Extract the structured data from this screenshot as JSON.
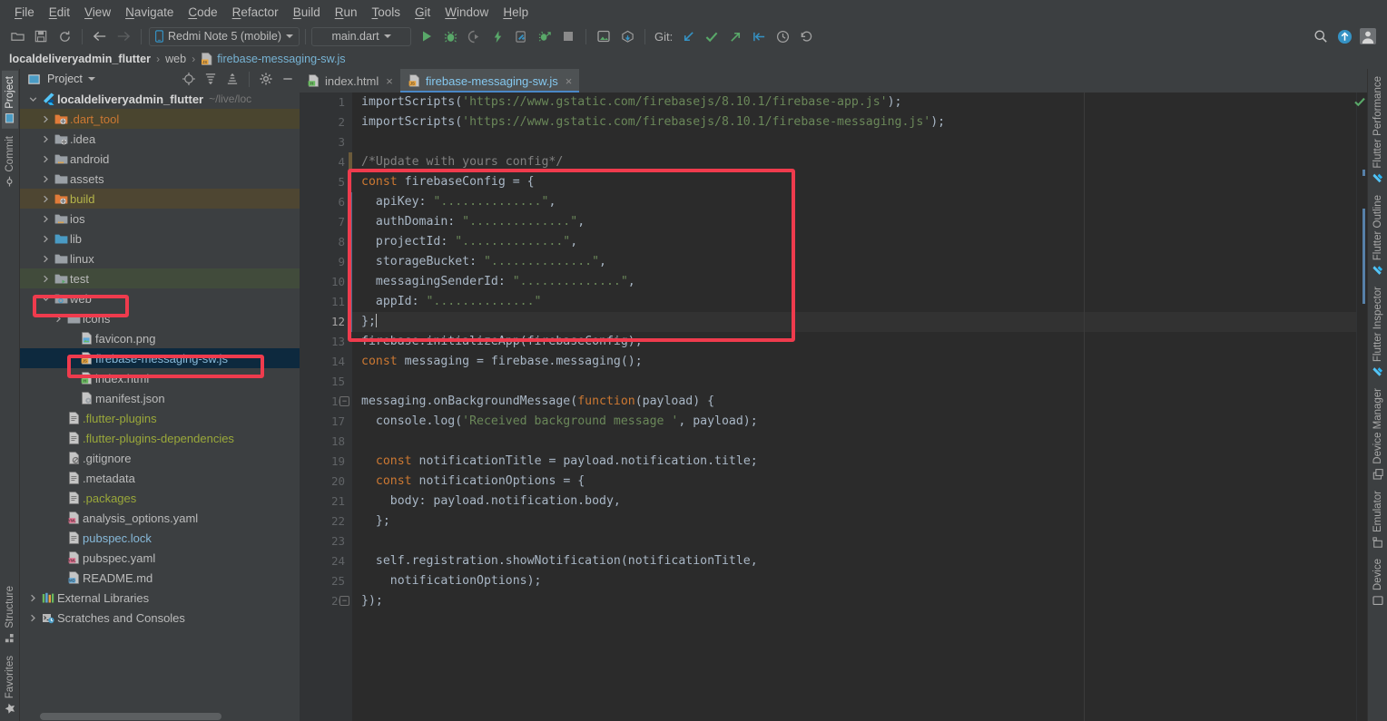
{
  "menubar": {
    "items": [
      "File",
      "Edit",
      "View",
      "Navigate",
      "Code",
      "Refactor",
      "Build",
      "Run",
      "Tools",
      "Git",
      "Window",
      "Help"
    ]
  },
  "toolbar": {
    "icons": [
      "open-folder-icon",
      "save-icon",
      "sync-icon"
    ],
    "nav_back": "back-arrow-icon",
    "nav_forward": "forward-arrow-icon",
    "device_selector": "Redmi Note 5 (mobile)",
    "run_config": "main.dart",
    "run_icons": [
      "run-icon",
      "debug-icon",
      "run-coverage-icon",
      "hot-reload-icon",
      "hot-restart-icon",
      "profile-icon",
      "stop-icon"
    ],
    "device_icons": [
      "open-android-emulator-icon",
      "device-file-explorer-icon"
    ],
    "git_label": "Git:",
    "git_icons": [
      "git-pull-icon",
      "git-commit-icon",
      "git-push-icon",
      "git-update-project-icon",
      "git-history-icon",
      "git-rollback-icon"
    ],
    "right_icons": [
      "search-icon",
      "update-available-icon",
      "avatar-icon"
    ]
  },
  "breadcrumb": {
    "project": "localdeliveryadmin_flutter",
    "folder": "web",
    "file": "firebase-messaging-sw.js",
    "separator": "›"
  },
  "left_rail": {
    "top": [
      {
        "label": "Project",
        "icon": "project-icon",
        "active": true
      },
      {
        "label": "Commit",
        "icon": "commit-icon",
        "active": false
      }
    ],
    "bottom": [
      {
        "label": "Structure",
        "icon": "structure-icon"
      },
      {
        "label": "Favorites",
        "icon": "star-icon"
      }
    ]
  },
  "right_rail": {
    "items": [
      {
        "label": "Flutter Performance",
        "icon": "flutter-icon"
      },
      {
        "label": "Flutter Outline",
        "icon": "flutter-icon"
      },
      {
        "label": "Flutter Inspector",
        "icon": "flutter-icon"
      },
      {
        "label": "Device Manager",
        "icon": "device-manager-icon"
      },
      {
        "label": "Emulator",
        "icon": "emulator-icon"
      },
      {
        "label": "Device",
        "icon": "device-icon"
      }
    ]
  },
  "project_panel": {
    "title": "Project",
    "title_caret": "chevron-down-icon",
    "toolbar_icons": [
      "select-opened-file-icon",
      "expand-all-icon",
      "collapse-all-icon",
      "settings-gear-icon",
      "hide-panel-icon"
    ],
    "tree": [
      {
        "label": "localdeliveryadmin_flutter",
        "path": "~/live/loc",
        "icon": "flutter-project-icon",
        "indent": 0,
        "arrow": "expanded",
        "bold": true,
        "highlight": "none"
      },
      {
        "label": ".dart_tool",
        "icon": "folder-excluded-icon",
        "indent": 1,
        "arrow": "collapsed",
        "color": "#cc7832",
        "highlight": "dart"
      },
      {
        "label": ".idea",
        "icon": "folder-module-icon",
        "indent": 1,
        "arrow": "collapsed",
        "color": "#bbbbbb",
        "highlight": "none"
      },
      {
        "label": "android",
        "icon": "folder-source-icon",
        "indent": 1,
        "arrow": "collapsed",
        "color": "#bbbbbb",
        "highlight": "none"
      },
      {
        "label": "assets",
        "icon": "folder-icon",
        "indent": 1,
        "arrow": "collapsed",
        "color": "#bbbbbb",
        "highlight": "none"
      },
      {
        "label": "build",
        "icon": "folder-excluded-icon",
        "indent": 1,
        "arrow": "collapsed",
        "color": "#b5b54a",
        "highlight": "build"
      },
      {
        "label": "ios",
        "icon": "folder-source-icon",
        "indent": 1,
        "arrow": "collapsed",
        "color": "#bbbbbb",
        "highlight": "none"
      },
      {
        "label": "lib",
        "icon": "folder-blue-icon",
        "indent": 1,
        "arrow": "collapsed",
        "color": "#bbbbbb",
        "highlight": "none"
      },
      {
        "label": "linux",
        "icon": "folder-icon",
        "indent": 1,
        "arrow": "collapsed",
        "color": "#bbbbbb",
        "highlight": "none"
      },
      {
        "label": "test",
        "icon": "folder-test-icon",
        "indent": 1,
        "arrow": "collapsed",
        "color": "#bbbbbb",
        "highlight": "test"
      },
      {
        "label": "web",
        "icon": "folder-web-icon",
        "indent": 1,
        "arrow": "expanded",
        "color": "#bbbbbb",
        "highlight": "none",
        "redbox": true
      },
      {
        "label": "icons",
        "icon": "folder-icon",
        "indent": 2,
        "arrow": "collapsed",
        "color": "#bbbbbb",
        "highlight": "none"
      },
      {
        "label": "favicon.png",
        "icon": "image-file-icon",
        "indent": 3,
        "arrow": "none",
        "color": "#bbbbbb",
        "highlight": "none"
      },
      {
        "label": "firebase-messaging-sw.js",
        "icon": "js-file-icon",
        "indent": 3,
        "arrow": "none",
        "color": "#87b9d9",
        "highlight": "selected",
        "redbox": true
      },
      {
        "label": "index.html",
        "icon": "html-file-icon",
        "indent": 3,
        "arrow": "none",
        "color": "#bbbbbb",
        "highlight": "none"
      },
      {
        "label": "manifest.json",
        "icon": "json-file-icon",
        "indent": 3,
        "arrow": "none",
        "color": "#bbbbbb",
        "highlight": "none"
      },
      {
        "label": ".flutter-plugins",
        "icon": "text-file-icon",
        "indent": 2,
        "arrow": "none",
        "color": "#9aa83a",
        "highlight": "none"
      },
      {
        "label": ".flutter-plugins-dependencies",
        "icon": "text-file-icon",
        "indent": 2,
        "arrow": "none",
        "color": "#9aa83a",
        "highlight": "none"
      },
      {
        "label": ".gitignore",
        "icon": "gitignore-file-icon",
        "indent": 2,
        "arrow": "none",
        "color": "#bbbbbb",
        "highlight": "none"
      },
      {
        "label": ".metadata",
        "icon": "text-file-icon",
        "indent": 2,
        "arrow": "none",
        "color": "#bbbbbb",
        "highlight": "none"
      },
      {
        "label": ".packages",
        "icon": "text-file-icon",
        "indent": 2,
        "arrow": "none",
        "color": "#9aa83a",
        "highlight": "none"
      },
      {
        "label": "analysis_options.yaml",
        "icon": "yaml-file-icon",
        "indent": 2,
        "arrow": "none",
        "color": "#bbbbbb",
        "highlight": "none"
      },
      {
        "label": "pubspec.lock",
        "icon": "text-file-icon",
        "indent": 2,
        "arrow": "none",
        "color": "#87b9d9",
        "highlight": "none"
      },
      {
        "label": "pubspec.yaml",
        "icon": "yaml-file-icon",
        "indent": 2,
        "arrow": "none",
        "color": "#bbbbbb",
        "highlight": "none"
      },
      {
        "label": "README.md",
        "icon": "markdown-file-icon",
        "indent": 2,
        "arrow": "none",
        "color": "#bbbbbb",
        "highlight": "none"
      },
      {
        "label": "External Libraries",
        "icon": "libraries-icon",
        "indent": 0,
        "arrow": "collapsed",
        "color": "#bbbbbb",
        "highlight": "none"
      },
      {
        "label": "Scratches and Consoles",
        "icon": "scratches-icon",
        "indent": 0,
        "arrow": "collapsed",
        "color": "#bbbbbb",
        "highlight": "none"
      }
    ]
  },
  "editor": {
    "tabs": [
      {
        "label": "index.html",
        "icon": "html-file-icon",
        "active": false,
        "close": "×"
      },
      {
        "label": "firebase-messaging-sw.js",
        "icon": "js-file-icon",
        "active": true,
        "close": "×"
      }
    ],
    "current_line": 12,
    "inspection_status": "ok-check-icon",
    "lines": [
      {
        "n": 1,
        "tokens": [
          {
            "t": "importScripts(",
            "c": "txt"
          },
          {
            "t": "'https://www.gstatic.com/firebasejs/8.10.1/firebase-app.js'",
            "c": "str"
          },
          {
            "t": ");",
            "c": "txt"
          }
        ]
      },
      {
        "n": 2,
        "tokens": [
          {
            "t": "importScripts(",
            "c": "txt"
          },
          {
            "t": "'https://www.gstatic.com/firebasejs/8.10.1/firebase-messaging.js'",
            "c": "str"
          },
          {
            "t": ");",
            "c": "txt"
          }
        ]
      },
      {
        "n": 3,
        "tokens": []
      },
      {
        "n": 4,
        "tokens": [
          {
            "t": "/*Update with yours config*/",
            "c": "cmt"
          }
        ]
      },
      {
        "n": 5,
        "tokens": [
          {
            "t": "const",
            "c": "kw"
          },
          {
            "t": " firebaseConfig = {",
            "c": "txt"
          }
        ]
      },
      {
        "n": 6,
        "tokens": [
          {
            "t": "  apiKey: ",
            "c": "txt"
          },
          {
            "t": "\"..............\"",
            "c": "str"
          },
          {
            "t": ",",
            "c": "txt"
          }
        ]
      },
      {
        "n": 7,
        "tokens": [
          {
            "t": "  authDomain: ",
            "c": "txt"
          },
          {
            "t": "\"..............\"",
            "c": "str"
          },
          {
            "t": ",",
            "c": "txt"
          }
        ]
      },
      {
        "n": 8,
        "tokens": [
          {
            "t": "  projectId: ",
            "c": "txt"
          },
          {
            "t": "\"..............\"",
            "c": "str"
          },
          {
            "t": ",",
            "c": "txt"
          }
        ]
      },
      {
        "n": 9,
        "tokens": [
          {
            "t": "  storageBucket: ",
            "c": "txt"
          },
          {
            "t": "\"..............\"",
            "c": "str"
          },
          {
            "t": ",",
            "c": "txt"
          }
        ]
      },
      {
        "n": 10,
        "tokens": [
          {
            "t": "  messagingSenderId: ",
            "c": "txt"
          },
          {
            "t": "\"..............\"",
            "c": "str"
          },
          {
            "t": ",",
            "c": "txt"
          }
        ]
      },
      {
        "n": 11,
        "tokens": [
          {
            "t": "  appId: ",
            "c": "txt"
          },
          {
            "t": "\"..............\"",
            "c": "str"
          }
        ]
      },
      {
        "n": 12,
        "tokens": [
          {
            "t": "};",
            "c": "txt"
          }
        ],
        "caret": true
      },
      {
        "n": 13,
        "tokens": [
          {
            "t": "firebase.initializeApp(firebaseConfig);",
            "c": "txt"
          }
        ]
      },
      {
        "n": 14,
        "tokens": [
          {
            "t": "const",
            "c": "kw"
          },
          {
            "t": " messaging = firebase.messaging();",
            "c": "txt"
          }
        ]
      },
      {
        "n": 15,
        "tokens": []
      },
      {
        "n": 16,
        "tokens": [
          {
            "t": "messaging.onBackgroundMessage(",
            "c": "txt"
          },
          {
            "t": "function",
            "c": "kw"
          },
          {
            "t": "(payload) {",
            "c": "txt"
          }
        ]
      },
      {
        "n": 17,
        "tokens": [
          {
            "t": "  console.log(",
            "c": "txt"
          },
          {
            "t": "'Received background message '",
            "c": "str"
          },
          {
            "t": ", payload);",
            "c": "txt"
          }
        ]
      },
      {
        "n": 18,
        "tokens": []
      },
      {
        "n": 19,
        "tokens": [
          {
            "t": "  ",
            "c": "txt"
          },
          {
            "t": "const",
            "c": "kw"
          },
          {
            "t": " notificationTitle = payload.notification.title;",
            "c": "txt"
          }
        ]
      },
      {
        "n": 20,
        "tokens": [
          {
            "t": "  ",
            "c": "txt"
          },
          {
            "t": "const",
            "c": "kw"
          },
          {
            "t": " notificationOptions = {",
            "c": "txt"
          }
        ]
      },
      {
        "n": 21,
        "tokens": [
          {
            "t": "    body: payload.notification.body,",
            "c": "txt"
          }
        ]
      },
      {
        "n": 22,
        "tokens": [
          {
            "t": "  };",
            "c": "txt"
          }
        ]
      },
      {
        "n": 23,
        "tokens": []
      },
      {
        "n": 24,
        "tokens": [
          {
            "t": "  self.registration.showNotification(notificationTitle,",
            "c": "txt"
          }
        ]
      },
      {
        "n": 25,
        "tokens": [
          {
            "t": "    notificationOptions);",
            "c": "txt"
          }
        ]
      },
      {
        "n": 26,
        "tokens": [
          {
            "t": "});",
            "c": "txt"
          }
        ]
      }
    ]
  },
  "annotations": {
    "color": "#ef3b4d",
    "boxes": [
      "web-folder-highlight",
      "firebase-messaging-sw-file-highlight",
      "firebase-config-code-highlight"
    ]
  }
}
